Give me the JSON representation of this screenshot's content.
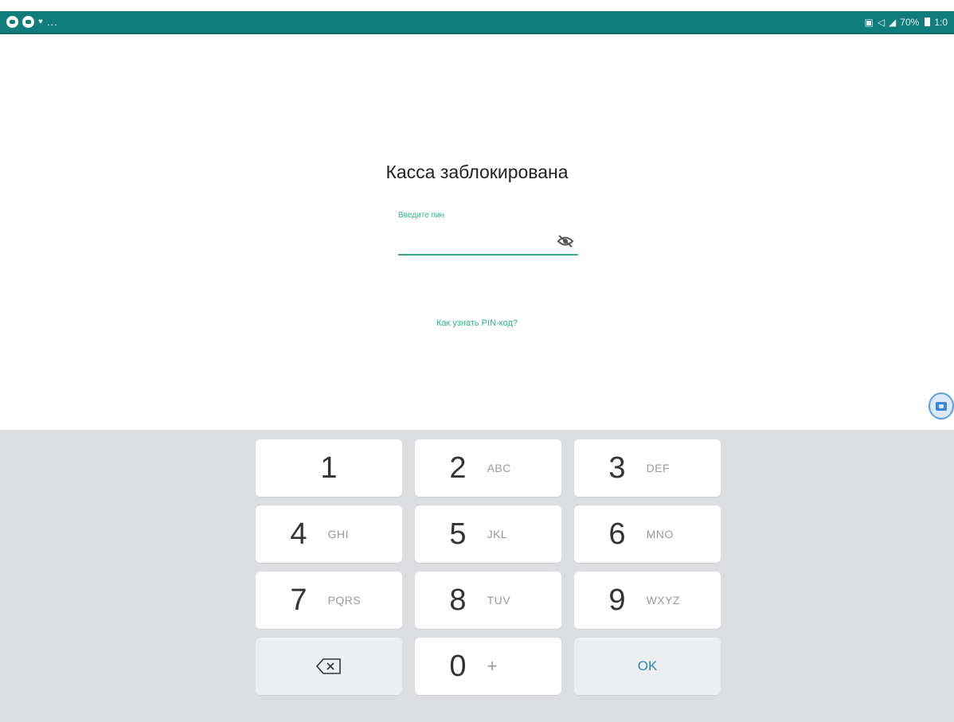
{
  "status_bar": {
    "left_dots": "...",
    "battery_percent": "70%",
    "clock": "1:0"
  },
  "lock_screen": {
    "title": "Касса заблокирована",
    "pin_label": "Введите пин",
    "pin_value": "",
    "help_link": "Как узнать PIN-код?"
  },
  "keypad": {
    "keys": [
      {
        "digit": "1",
        "letters": ""
      },
      {
        "digit": "2",
        "letters": "ABC"
      },
      {
        "digit": "3",
        "letters": "DEF"
      },
      {
        "digit": "4",
        "letters": "GHI"
      },
      {
        "digit": "5",
        "letters": "JKL"
      },
      {
        "digit": "6",
        "letters": "MNO"
      },
      {
        "digit": "7",
        "letters": "PQRS"
      },
      {
        "digit": "8",
        "letters": "TUV"
      },
      {
        "digit": "9",
        "letters": "WXYZ"
      },
      {
        "digit": "0",
        "letters": "+"
      }
    ],
    "ok_label": "OK",
    "backspace_icon": "backspace-icon"
  },
  "colors": {
    "status_bar": "#107c7c",
    "accent": "#2bb58a",
    "keyboard_bg": "#dcdde1",
    "ok_text": "#2b88b0"
  }
}
